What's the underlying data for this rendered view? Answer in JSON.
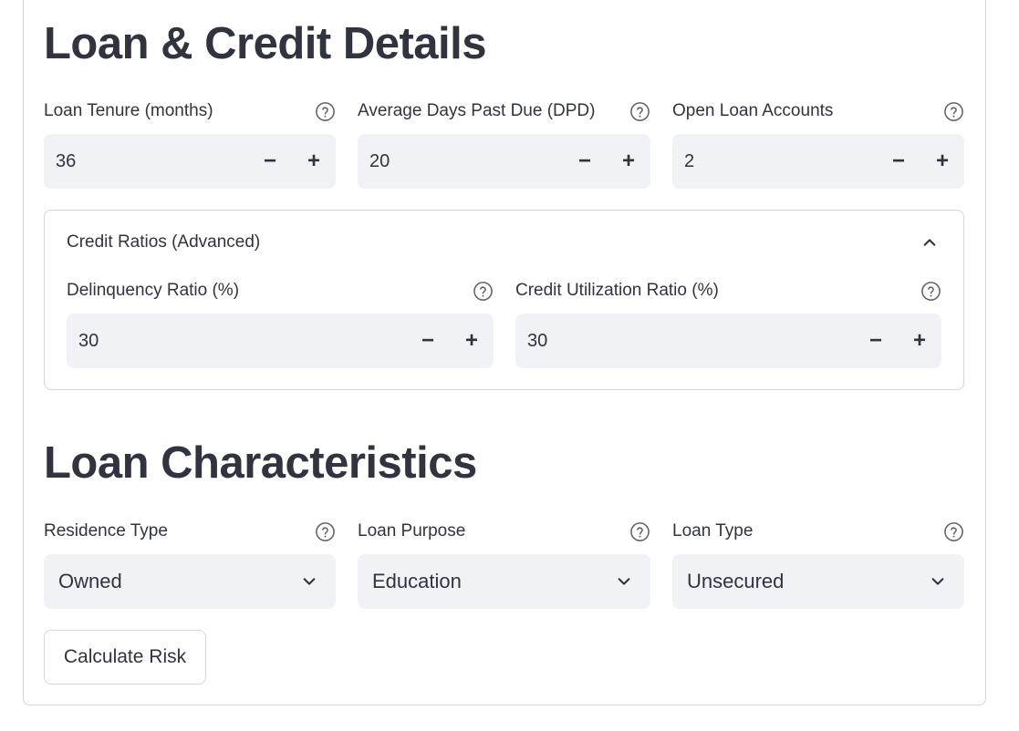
{
  "sections": {
    "loan_credit_title": "Loan & Credit Details",
    "loan_characteristics_title": "Loan Characteristics"
  },
  "fields": {
    "loan_tenure": {
      "label": "Loan Tenure (months)",
      "value": "36"
    },
    "avg_dpd": {
      "label": "Average Days Past Due (DPD)",
      "value": "20"
    },
    "open_loans": {
      "label": "Open Loan Accounts",
      "value": "2"
    },
    "delinquency_ratio": {
      "label": "Delinquency Ratio (%)",
      "value": "30"
    },
    "credit_utilization": {
      "label": "Credit Utilization Ratio (%)",
      "value": "30"
    }
  },
  "expander": {
    "title": "Credit Ratios (Advanced)",
    "state": "expanded"
  },
  "selects": {
    "residence_type": {
      "label": "Residence Type",
      "value": "Owned"
    },
    "loan_purpose": {
      "label": "Loan Purpose",
      "value": "Education"
    },
    "loan_type": {
      "label": "Loan Type",
      "value": "Unsecured"
    }
  },
  "stepper": {
    "minus": "−",
    "plus": "+"
  },
  "actions": {
    "calculate_label": "Calculate Risk"
  },
  "icons": {
    "help": "help-circle-icon",
    "chevron_down": "chevron-down-icon",
    "chevron_up": "chevron-up-icon"
  },
  "colors": {
    "input_bg": "#f0f2f6",
    "text": "#31333f",
    "border": "#d6d6d9"
  }
}
